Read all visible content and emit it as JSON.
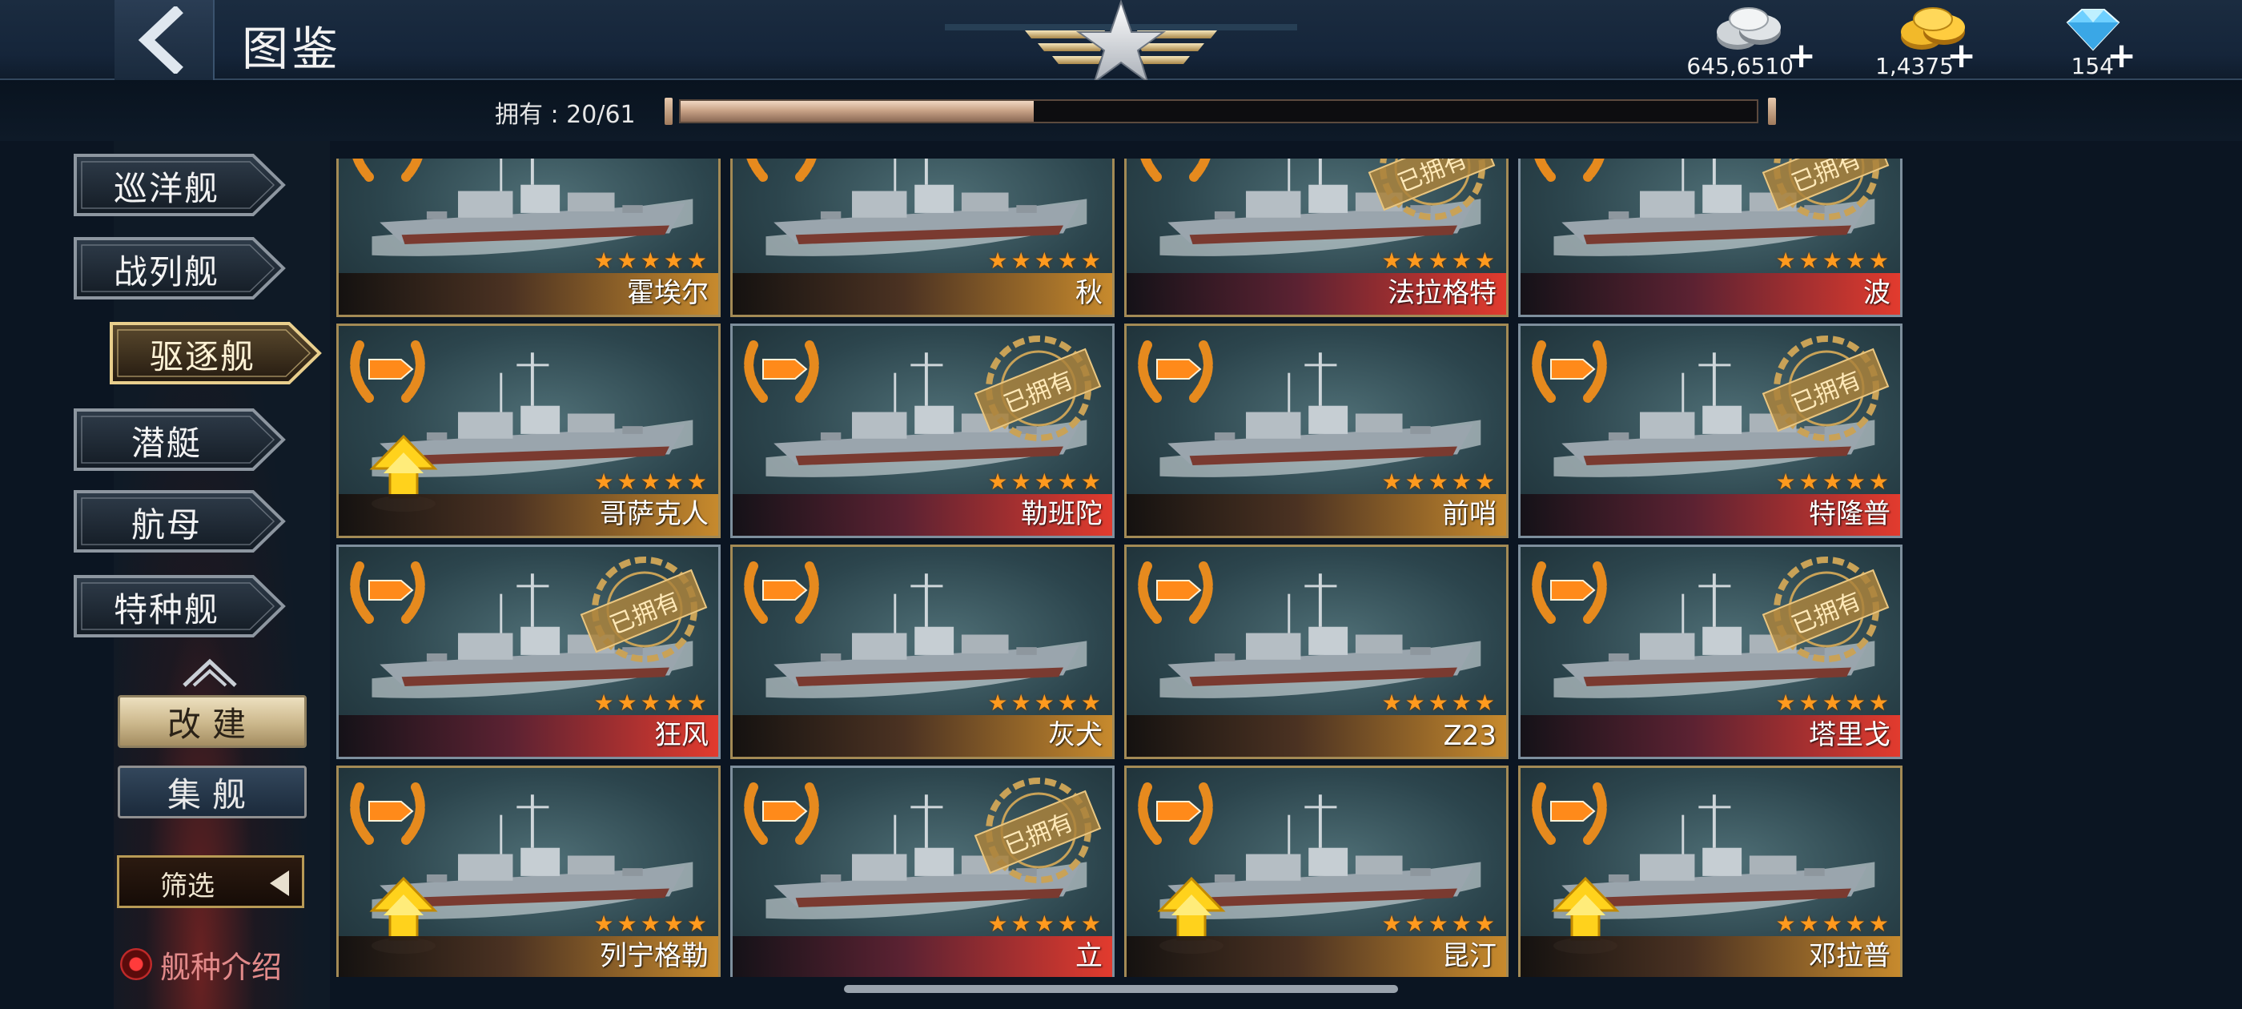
{
  "header": {
    "title": "图鉴",
    "currencies": [
      {
        "name": "silver",
        "value": "645,6510",
        "icon": "silver-coins-icon"
      },
      {
        "name": "gold",
        "value": "1,4375",
        "icon": "gold-coins-icon"
      },
      {
        "name": "gem",
        "value": "154",
        "icon": "diamond-icon"
      }
    ],
    "plus": "+"
  },
  "progress": {
    "label": "拥有 : 20/61",
    "owned": 20,
    "total": 61
  },
  "sidebar": {
    "categories": [
      {
        "label": "巡洋舰",
        "active": false
      },
      {
        "label": "战列舰",
        "active": false
      },
      {
        "label": "驱逐舰",
        "active": true
      },
      {
        "label": "潜艇",
        "active": false
      },
      {
        "label": "航母",
        "active": false
      },
      {
        "label": "特种舰",
        "active": false
      }
    ],
    "rebuild_label": "改建",
    "fleet_label": "集舰",
    "filter_label": "筛选",
    "intro_label": "舰种介绍"
  },
  "colors": {
    "gold_frame": "#a38a55",
    "steel_frame": "#7e8f9d",
    "star": "#ff9a1e"
  },
  "owned_label": "已拥有",
  "stars": "★★★★★",
  "ships": [
    {
      "name": "霍埃尔",
      "bar": "gold",
      "frame": "gold",
      "owned": false,
      "upgrade": false
    },
    {
      "name": "秋",
      "bar": "gold",
      "frame": "gold",
      "owned": false,
      "upgrade": false
    },
    {
      "name": "法拉格特",
      "bar": "red",
      "frame": "gold",
      "owned": true,
      "upgrade": false
    },
    {
      "name": "波",
      "bar": "red",
      "frame": "steel",
      "owned": true,
      "upgrade": false
    },
    {
      "name": "哥萨克人",
      "bar": "gold",
      "frame": "gold",
      "owned": false,
      "upgrade": true
    },
    {
      "name": "勒班陀",
      "bar": "red",
      "frame": "steel",
      "owned": true,
      "upgrade": false
    },
    {
      "name": "前哨",
      "bar": "gold",
      "frame": "gold",
      "owned": false,
      "upgrade": false
    },
    {
      "name": "特隆普",
      "bar": "red",
      "frame": "steel",
      "owned": true,
      "upgrade": false
    },
    {
      "name": "狂风",
      "bar": "red",
      "frame": "steel",
      "owned": true,
      "upgrade": false
    },
    {
      "name": "灰犬",
      "bar": "gold",
      "frame": "gold",
      "owned": false,
      "upgrade": false
    },
    {
      "name": "Z23",
      "bar": "gold",
      "frame": "gold",
      "owned": false,
      "upgrade": false
    },
    {
      "name": "塔里戈",
      "bar": "red",
      "frame": "steel",
      "owned": true,
      "upgrade": false
    },
    {
      "name": "列宁格勒",
      "bar": "gold",
      "frame": "gold",
      "owned": false,
      "upgrade": true
    },
    {
      "name": "立",
      "bar": "red",
      "frame": "steel",
      "owned": true,
      "upgrade": false
    },
    {
      "name": "昆汀",
      "bar": "gold",
      "frame": "gold",
      "owned": false,
      "upgrade": true
    },
    {
      "name": "邓拉普",
      "bar": "gold",
      "frame": "gold",
      "owned": false,
      "upgrade": true
    }
  ]
}
